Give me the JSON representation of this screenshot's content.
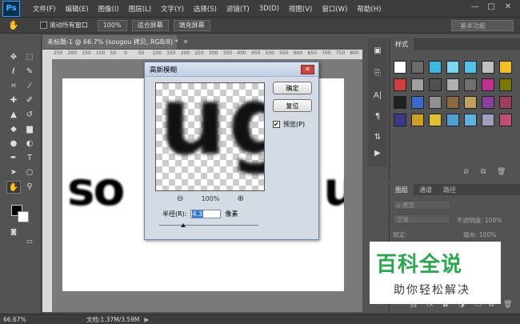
{
  "app": {
    "logo": "Ps",
    "menu": [
      "文件(F)",
      "编辑(E)",
      "图像(I)",
      "图层(L)",
      "文字(Y)",
      "选择(S)",
      "滤镜(T)",
      "3D(D)",
      "视图(V)",
      "窗口(W)",
      "帮助(H)"
    ],
    "window_controls": [
      "—",
      "□",
      "✕"
    ]
  },
  "options_bar": {
    "scroll_all_label": "滚动所有窗口",
    "zoom_button": "100%",
    "fit_screen_button": "适合屏幕",
    "fill_screen_button": "填充屏幕",
    "workspace": "基本功能"
  },
  "document": {
    "tab_title": "未标题-1 @ 66.7% (sougou 拷贝, RGB/8) *",
    "ruler_marks": [
      "250",
      "200",
      "150",
      "100",
      "50",
      "0",
      "50",
      "100",
      "150",
      "200",
      "250",
      "300",
      "350",
      "400",
      "450",
      "500",
      "550",
      "600",
      "650",
      "700",
      "750",
      "800"
    ],
    "canvas_text_left": "so",
    "canvas_text_right": "u"
  },
  "status_bar": {
    "zoom": "66.67%",
    "doc_info": "文档:1.37M/3.59M"
  },
  "dialog": {
    "title": "高斯模糊",
    "close": "✕",
    "preview_text": "ug",
    "ok_button": "确定",
    "reset_button": "复位",
    "preview_label": "预览(P)",
    "preview_checked": true,
    "zoom_out": "⊖",
    "zoom_value": "100%",
    "zoom_in": "⊕",
    "radius_label": "半径(R):",
    "radius_value": "4.3",
    "radius_unit": "像素",
    "radius_slider_fraction": 0.24
  },
  "swatches_panel": {
    "tab": "样式",
    "colors": [
      "#ffffff",
      "#6b6b6b",
      "#3fb8e0",
      "#7ad6ee",
      "#52c2e8",
      "#c0c0c0",
      "#f0c020",
      "#d04040",
      "#a0a0a0",
      "#505050",
      "#b0b0b0",
      "#707070",
      "#c03090",
      "#7a7a00",
      "#202020",
      "#3a6ad0",
      "#909090",
      "#8a6a40",
      "#c0a060",
      "#8a40a0",
      "#a04060",
      "#3a3a8a",
      "#d0a020",
      "#e0c030",
      "#50a0d0",
      "#60b0e0",
      "#a0a0c0",
      "#c05070"
    ]
  },
  "layers_panel": {
    "tabs": [
      "图层",
      "通道",
      "路径"
    ],
    "filter_label": "ρ 类型",
    "blend_mode": "正常",
    "opacity_label": "不透明度: 100%",
    "lock_label": "锁定:",
    "fill_label": "填充: 100%"
  },
  "watermark": {
    "big": "百科全说",
    "small": "助你轻松解决"
  }
}
